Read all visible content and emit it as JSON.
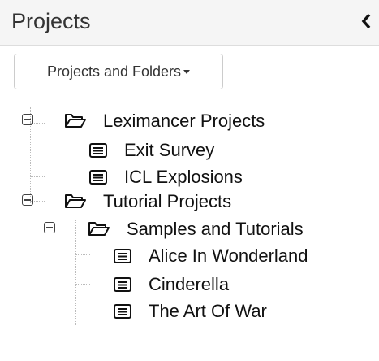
{
  "panel": {
    "title": "Projects",
    "collapse_icon": "chevron-left-icon"
  },
  "toolbar": {
    "view_dropdown_label": "Projects and Folders"
  },
  "tree": {
    "leximancer_projects": {
      "label": "Leximancer Projects",
      "icon": "folder-open-icon",
      "expanded": true,
      "children": [
        {
          "label": "Exit Survey",
          "icon": "list-icon"
        },
        {
          "label": "ICL Explosions",
          "icon": "list-icon"
        }
      ]
    },
    "tutorial_projects": {
      "label": "Tutorial Projects",
      "icon": "folder-open-icon",
      "expanded": true,
      "samples_and_tutorials": {
        "label": "Samples and Tutorials",
        "icon": "folder-open-icon",
        "expanded": true,
        "children": [
          {
            "label": "Alice In Wonderland",
            "icon": "list-icon"
          },
          {
            "label": "Cinderella",
            "icon": "list-icon"
          },
          {
            "label": "The Art Of War",
            "icon": "list-icon"
          }
        ]
      }
    }
  }
}
